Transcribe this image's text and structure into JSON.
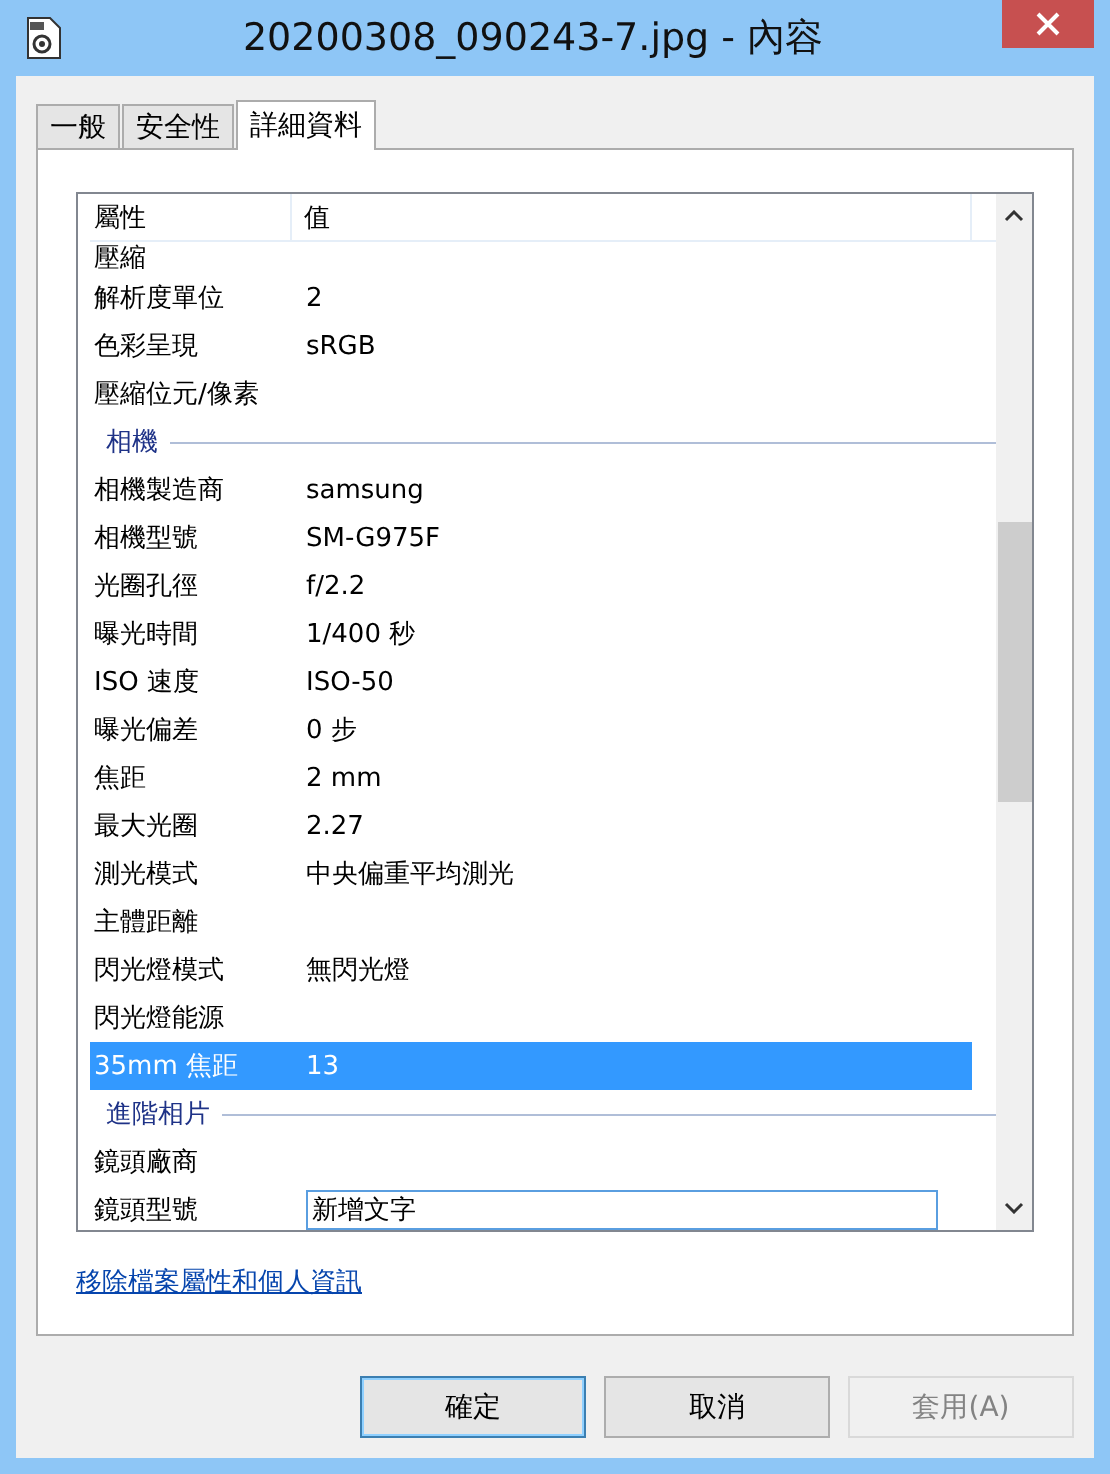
{
  "window": {
    "title": "20200308_090243-7.jpg - 內容"
  },
  "tabs": [
    {
      "label": "一般",
      "selected": false
    },
    {
      "label": "安全性",
      "selected": false
    },
    {
      "label": "詳細資料",
      "selected": true
    }
  ],
  "table": {
    "columns": [
      "屬性",
      "值"
    ],
    "rows": [
      {
        "kind": "row",
        "name": "壓縮",
        "value": "",
        "selected": false
      },
      {
        "kind": "row",
        "name": "解析度單位",
        "value": "2",
        "selected": false
      },
      {
        "kind": "row",
        "name": "色彩呈現",
        "value": "sRGB",
        "selected": false
      },
      {
        "kind": "row",
        "name": "壓縮位元/像素",
        "value": "",
        "selected": false
      },
      {
        "kind": "group",
        "name": "相機"
      },
      {
        "kind": "row",
        "name": "相機製造商",
        "value": "samsung",
        "selected": false
      },
      {
        "kind": "row",
        "name": "相機型號",
        "value": "SM-G975F",
        "selected": false
      },
      {
        "kind": "row",
        "name": "光圈孔徑",
        "value": "f/2.2",
        "selected": false
      },
      {
        "kind": "row",
        "name": "曝光時間",
        "value": "1/400 秒",
        "selected": false
      },
      {
        "kind": "row",
        "name": "ISO 速度",
        "value": "ISO-50",
        "selected": false
      },
      {
        "kind": "row",
        "name": "曝光偏差",
        "value": "0 步",
        "selected": false
      },
      {
        "kind": "row",
        "name": "焦距",
        "value": "2 mm",
        "selected": false
      },
      {
        "kind": "row",
        "name": "最大光圈",
        "value": "2.27",
        "selected": false
      },
      {
        "kind": "row",
        "name": "測光模式",
        "value": "中央偏重平均測光",
        "selected": false
      },
      {
        "kind": "row",
        "name": "主體距離",
        "value": "",
        "selected": false
      },
      {
        "kind": "row",
        "name": "閃光燈模式",
        "value": "無閃光燈",
        "selected": false
      },
      {
        "kind": "row",
        "name": "閃光燈能源",
        "value": "",
        "selected": false
      },
      {
        "kind": "row",
        "name": "35mm 焦距",
        "value": "13",
        "selected": true
      },
      {
        "kind": "group",
        "name": "進階相片"
      },
      {
        "kind": "row",
        "name": "鏡頭廠商",
        "value": "",
        "selected": false
      },
      {
        "kind": "edit",
        "name": "鏡頭型號",
        "value": "新增文字",
        "selected": false
      }
    ]
  },
  "link": "移除檔案屬性和個人資訊",
  "buttons": [
    {
      "label": "確定",
      "disabled": false,
      "default": true
    },
    {
      "label": "取消",
      "disabled": false,
      "default": false
    },
    {
      "label": "套用(A)",
      "disabled": true,
      "default": false
    }
  ]
}
